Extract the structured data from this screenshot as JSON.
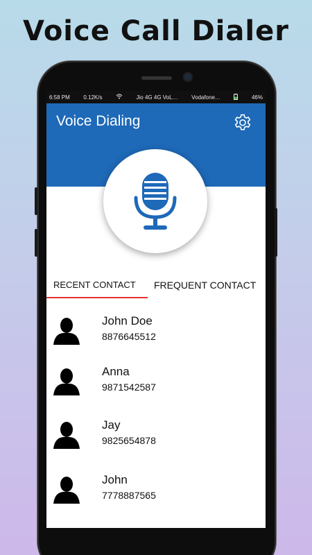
{
  "promo": {
    "title": "Voice Call Dialer"
  },
  "statusbar": {
    "time": "6:58 PM",
    "speed": "0.12K/s",
    "carrier1": "Jio 4G 4G VoL…",
    "carrier2": "Vodafone…",
    "battery": "46%"
  },
  "app": {
    "title": "Voice Dialing",
    "settings_icon": "gear-icon",
    "mic_icon": "microphone-icon",
    "accent": "#1e69b8"
  },
  "tabs": {
    "recent": "RECENT CONTACT",
    "frequent": "FREQUENT CONTACT",
    "indicator_color": "#e53030"
  },
  "contacts": [
    {
      "name": "John Doe",
      "phone": "8876645512"
    },
    {
      "name": "Anna",
      "phone": "9871542587"
    },
    {
      "name": "Jay",
      "phone": "9825654878"
    },
    {
      "name": "John",
      "phone": "7778887565"
    }
  ]
}
